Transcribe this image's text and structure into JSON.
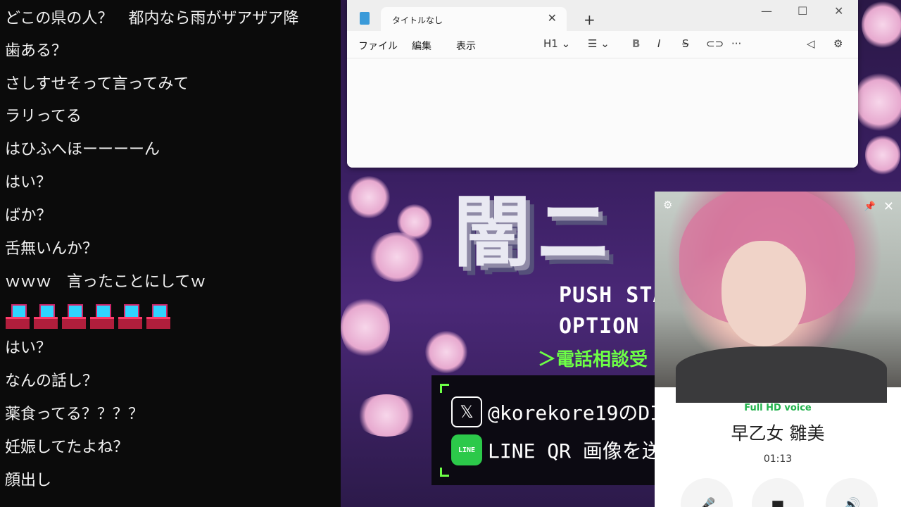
{
  "chat": {
    "lines": [
      "どこの県の人？　都内なら雨がザアザア降",
      "歯ある？",
      "さしすせそって言ってみて",
      "ラリってる",
      "はひふへほーーーーん",
      "はい？",
      "ばか？",
      "舌無いんか？",
      "ｗｗｗ　言ったことにしてｗ",
      "はい？",
      "なんの話し？",
      "薬食ってる？？？？",
      "妊娠してたよね？",
      "顔出し"
    ],
    "emoji_count": 6,
    "emoji_icon": "pixel-pc-emoji"
  },
  "stream": {
    "logo_text": "闇ニ",
    "menu_push": "PUSH STA",
    "menu_option": "OPTION",
    "menu_phone": "＞電話相談受",
    "contact_x": "@korekore19のDI",
    "contact_line": "LINE QR 画像を送",
    "line_badge": "LINE",
    "x_badge": "𝕏"
  },
  "notepad": {
    "tab_title": "タイトルなし",
    "menus": [
      "ファイル",
      "編集",
      "表示"
    ],
    "heading_label": "H1",
    "accent": "#3a9ad9"
  },
  "call": {
    "quality": "Full HD voice",
    "name": "早乙女 雛美",
    "duration": "01:13",
    "quality_color": "#22b24c"
  }
}
